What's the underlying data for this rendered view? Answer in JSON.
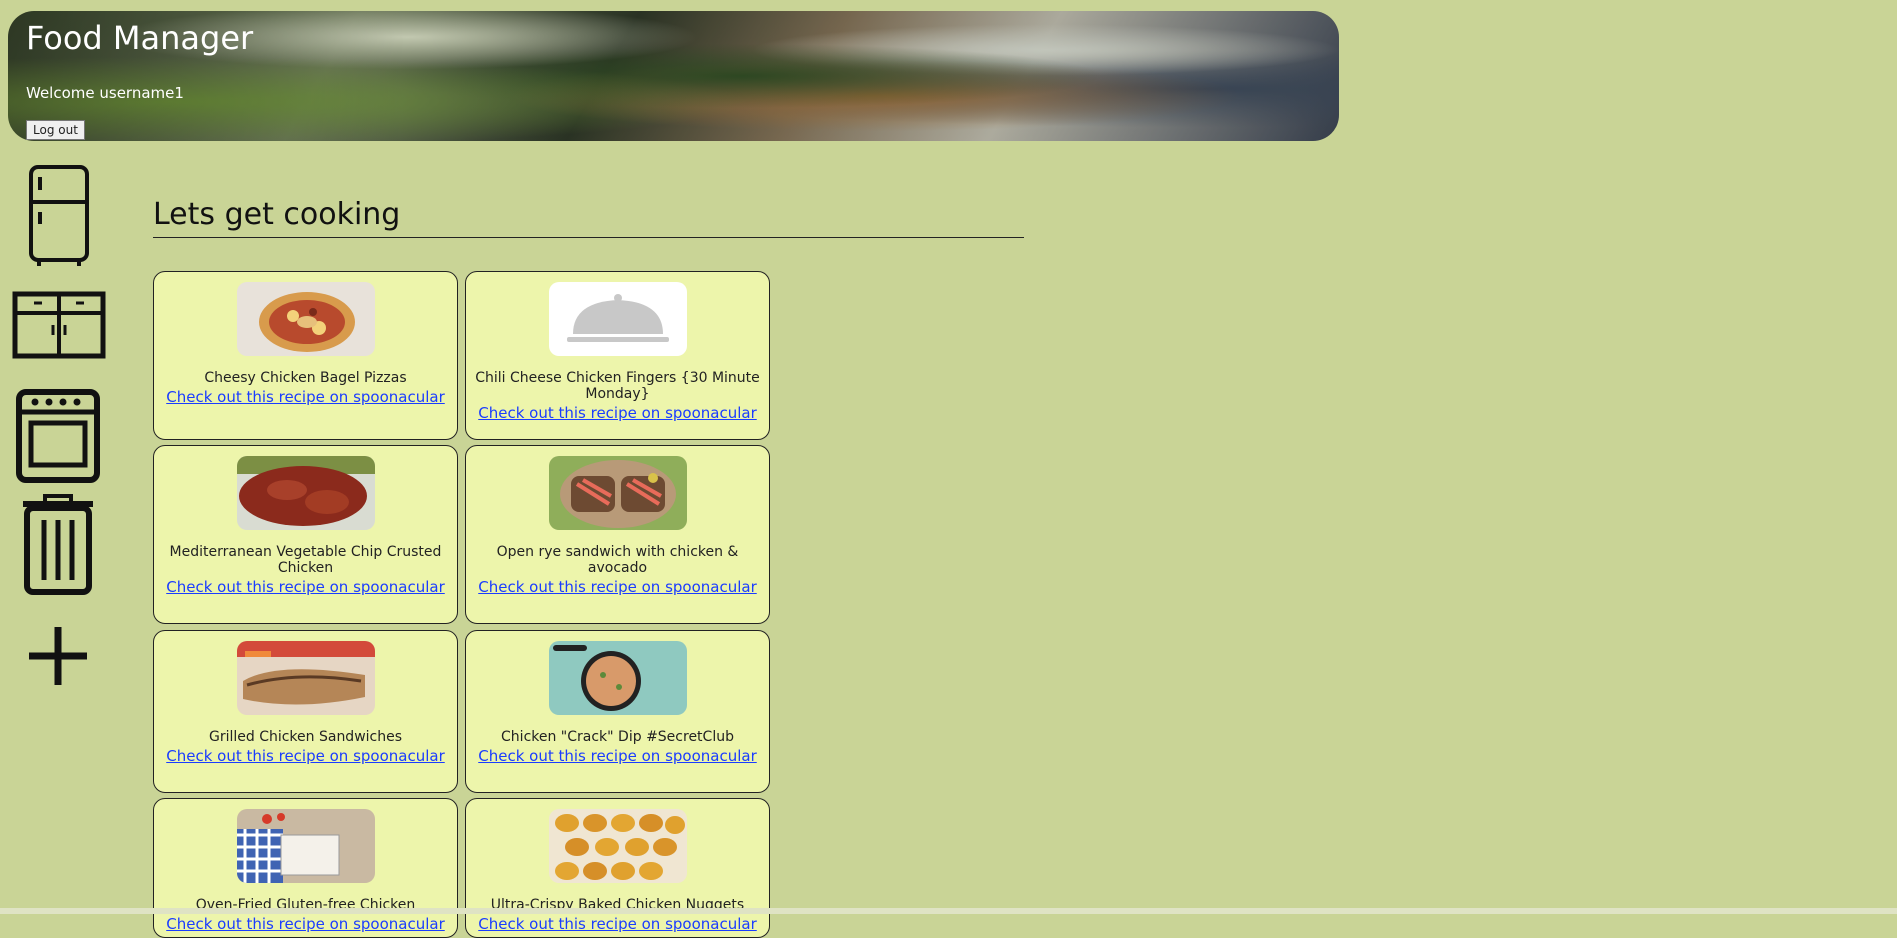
{
  "header": {
    "title": "Food Manager",
    "welcome": "Welcome username1",
    "logout_label": "Log out"
  },
  "sidebar": {
    "items": [
      {
        "name": "fridge",
        "icon": "fridge-icon"
      },
      {
        "name": "pantry",
        "icon": "cabinet-icon"
      },
      {
        "name": "cook",
        "icon": "oven-icon"
      },
      {
        "name": "trash",
        "icon": "trash-icon"
      },
      {
        "name": "add",
        "icon": "plus-icon"
      }
    ]
  },
  "main": {
    "heading": "Lets get cooking",
    "link_label": "Check out this recipe on spoonacular",
    "recipes": [
      {
        "title": "Cheesy Chicken Bagel Pizzas",
        "link": "Check out this recipe on spoonacular"
      },
      {
        "title": "Chili Cheese Chicken Fingers {30 Minute Monday}",
        "link": "Check out this recipe on spoonacular"
      },
      {
        "title": "Mediterranean Vegetable Chip Crusted Chicken",
        "link": "Check out this recipe on spoonacular"
      },
      {
        "title": "Open rye sandwich with chicken & avocado",
        "link": "Check out this recipe on spoonacular"
      },
      {
        "title": "Grilled Chicken Sandwiches",
        "link": "Check out this recipe on spoonacular"
      },
      {
        "title": "Chicken \"Crack\" Dip #SecretClub",
        "link": "Check out this recipe on spoonacular"
      },
      {
        "title": "Oven-Fried Gluten-free Chicken",
        "link": "Check out this recipe on spoonacular"
      },
      {
        "title": "Ultra-Crispy Baked Chicken Nuggets",
        "link": "Check out this recipe on spoonacular"
      }
    ]
  },
  "colors": {
    "background": "#c9d496",
    "card": "#edf5ab",
    "link": "#1a3cff"
  }
}
